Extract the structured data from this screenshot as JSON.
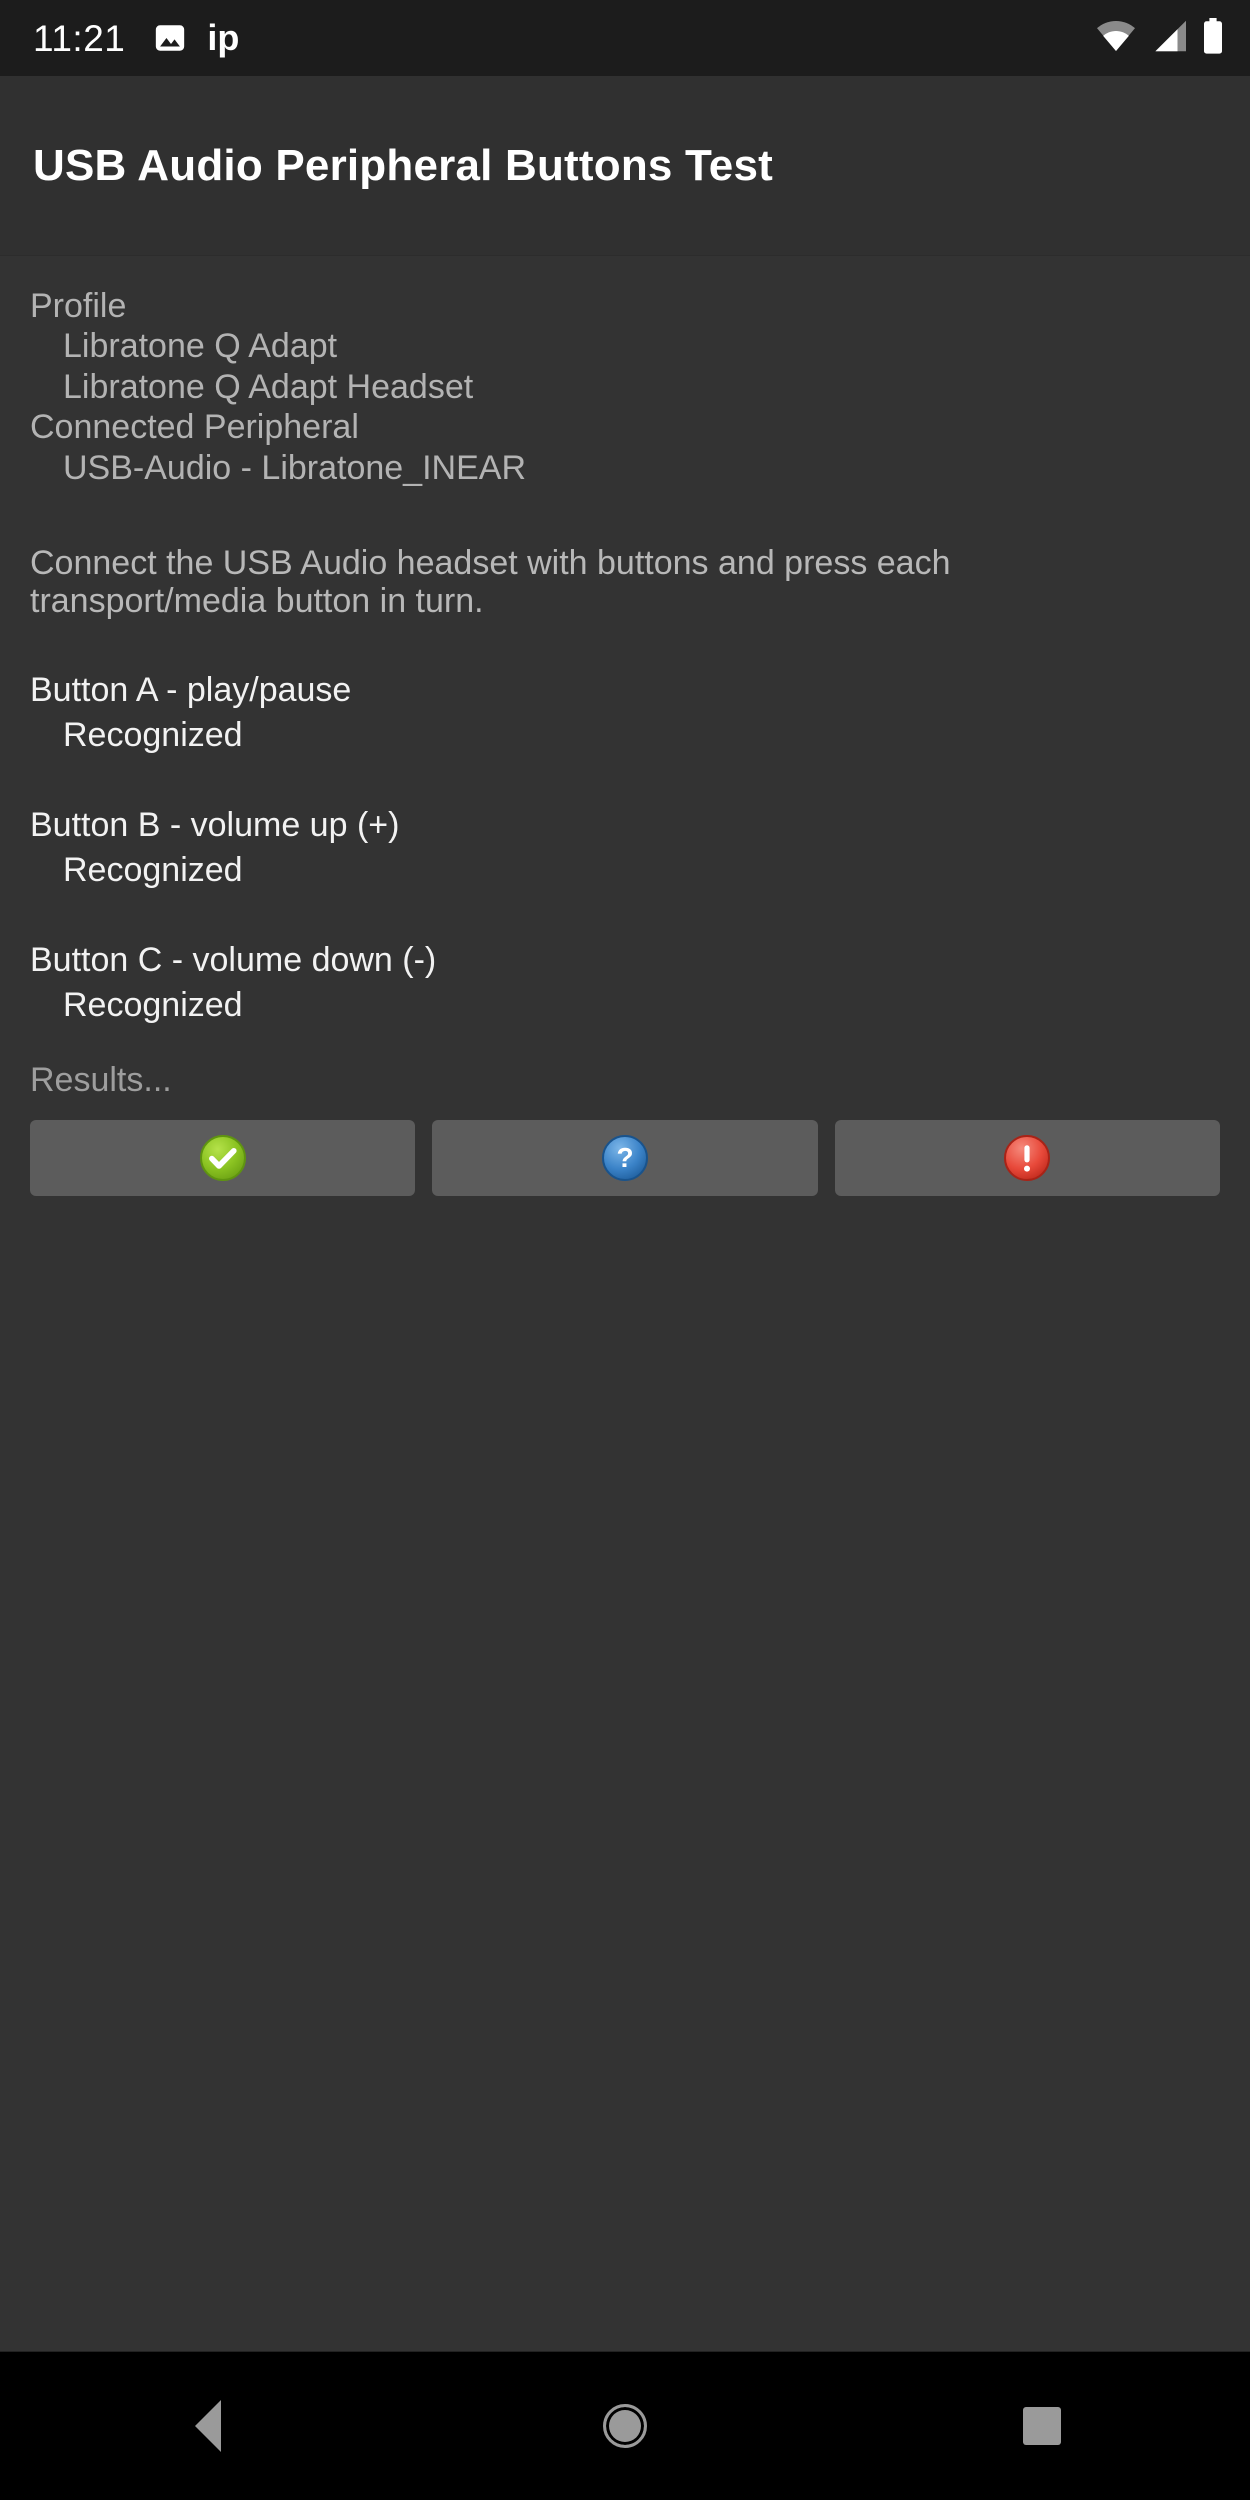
{
  "status_bar": {
    "time": "11:21",
    "notification_label": "ip",
    "icons": [
      "image-icon",
      "wifi-icon",
      "cellular-signal-icon",
      "battery-icon"
    ]
  },
  "app_bar": {
    "title": "USB Audio Peripheral Buttons Test"
  },
  "info": {
    "profile_heading": "Profile",
    "profile_name": "Libratone Q Adapt",
    "profile_variant": "Libratone Q Adapt Headset",
    "peripheral_heading": "Connected Peripheral",
    "peripheral_name": "USB-Audio - Libratone_INEAR"
  },
  "instructions": "Connect the USB Audio headset with buttons and press each transport/media button in turn.",
  "buttons": [
    {
      "label": "Button A - play/pause",
      "status": "Recognized"
    },
    {
      "label": "Button B - volume up (+)",
      "status": "Recognized"
    },
    {
      "label": "Button C - volume down (-)",
      "status": "Recognized"
    }
  ],
  "results": {
    "label": "Results...",
    "actions": [
      {
        "name": "pass",
        "icon": "green-check-icon",
        "color": "#8ac221"
      },
      {
        "name": "info",
        "icon": "blue-question-mark-icon",
        "color": "#3b83c8"
      },
      {
        "name": "fail",
        "icon": "red-exclamation-icon",
        "color": "#e8493a"
      }
    ]
  },
  "nav_bar": {
    "back": "back-button",
    "home": "home-button",
    "recents": "recents-button"
  }
}
